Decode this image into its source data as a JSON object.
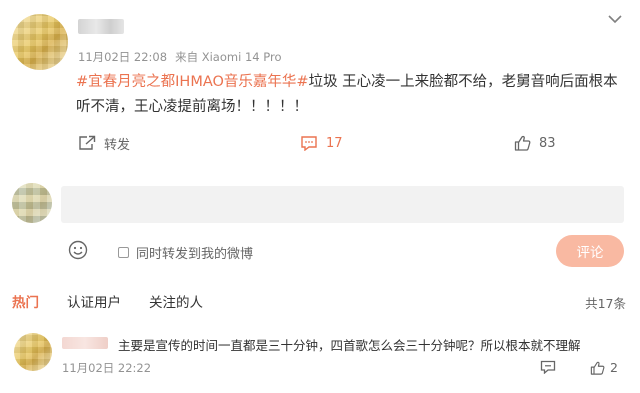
{
  "post": {
    "timestamp": "11月02日 22:08",
    "source": "来自 Xiaomi 14 Pro",
    "topic": "#宜春月亮之都IHMAO音乐嘉年华#",
    "body": "垃圾 王心凌一上来脸都不给，老舅音响后面根本听不清，王心凌提前离场！！！！！"
  },
  "actions": {
    "repost_label": "转发",
    "comment_count": "17",
    "like_count": "83"
  },
  "composer": {
    "input_value": "",
    "also_repost_label": "同时转发到我的微博",
    "submit_label": "评论"
  },
  "tabs": [
    {
      "label": "热门"
    },
    {
      "label": "认证用户"
    },
    {
      "label": "关注的人"
    }
  ],
  "total_count": "共17条",
  "comments": [
    {
      "text": "主要是宣传的时间一直都是三十分钟，四首歌怎么会三十分钟呢？所以根本就不理解",
      "time": "11月02日 22:22",
      "like_count": "2"
    }
  ],
  "colors": {
    "accent": "#eb7350",
    "submit_disabled": "#f9b9a2",
    "meta_gray": "#939393",
    "input_bg": "#f2f2f2"
  },
  "icons": [
    "chevron-down-icon",
    "repost-icon",
    "comment-icon",
    "like-icon",
    "emoji-icon",
    "reply-icon"
  ]
}
